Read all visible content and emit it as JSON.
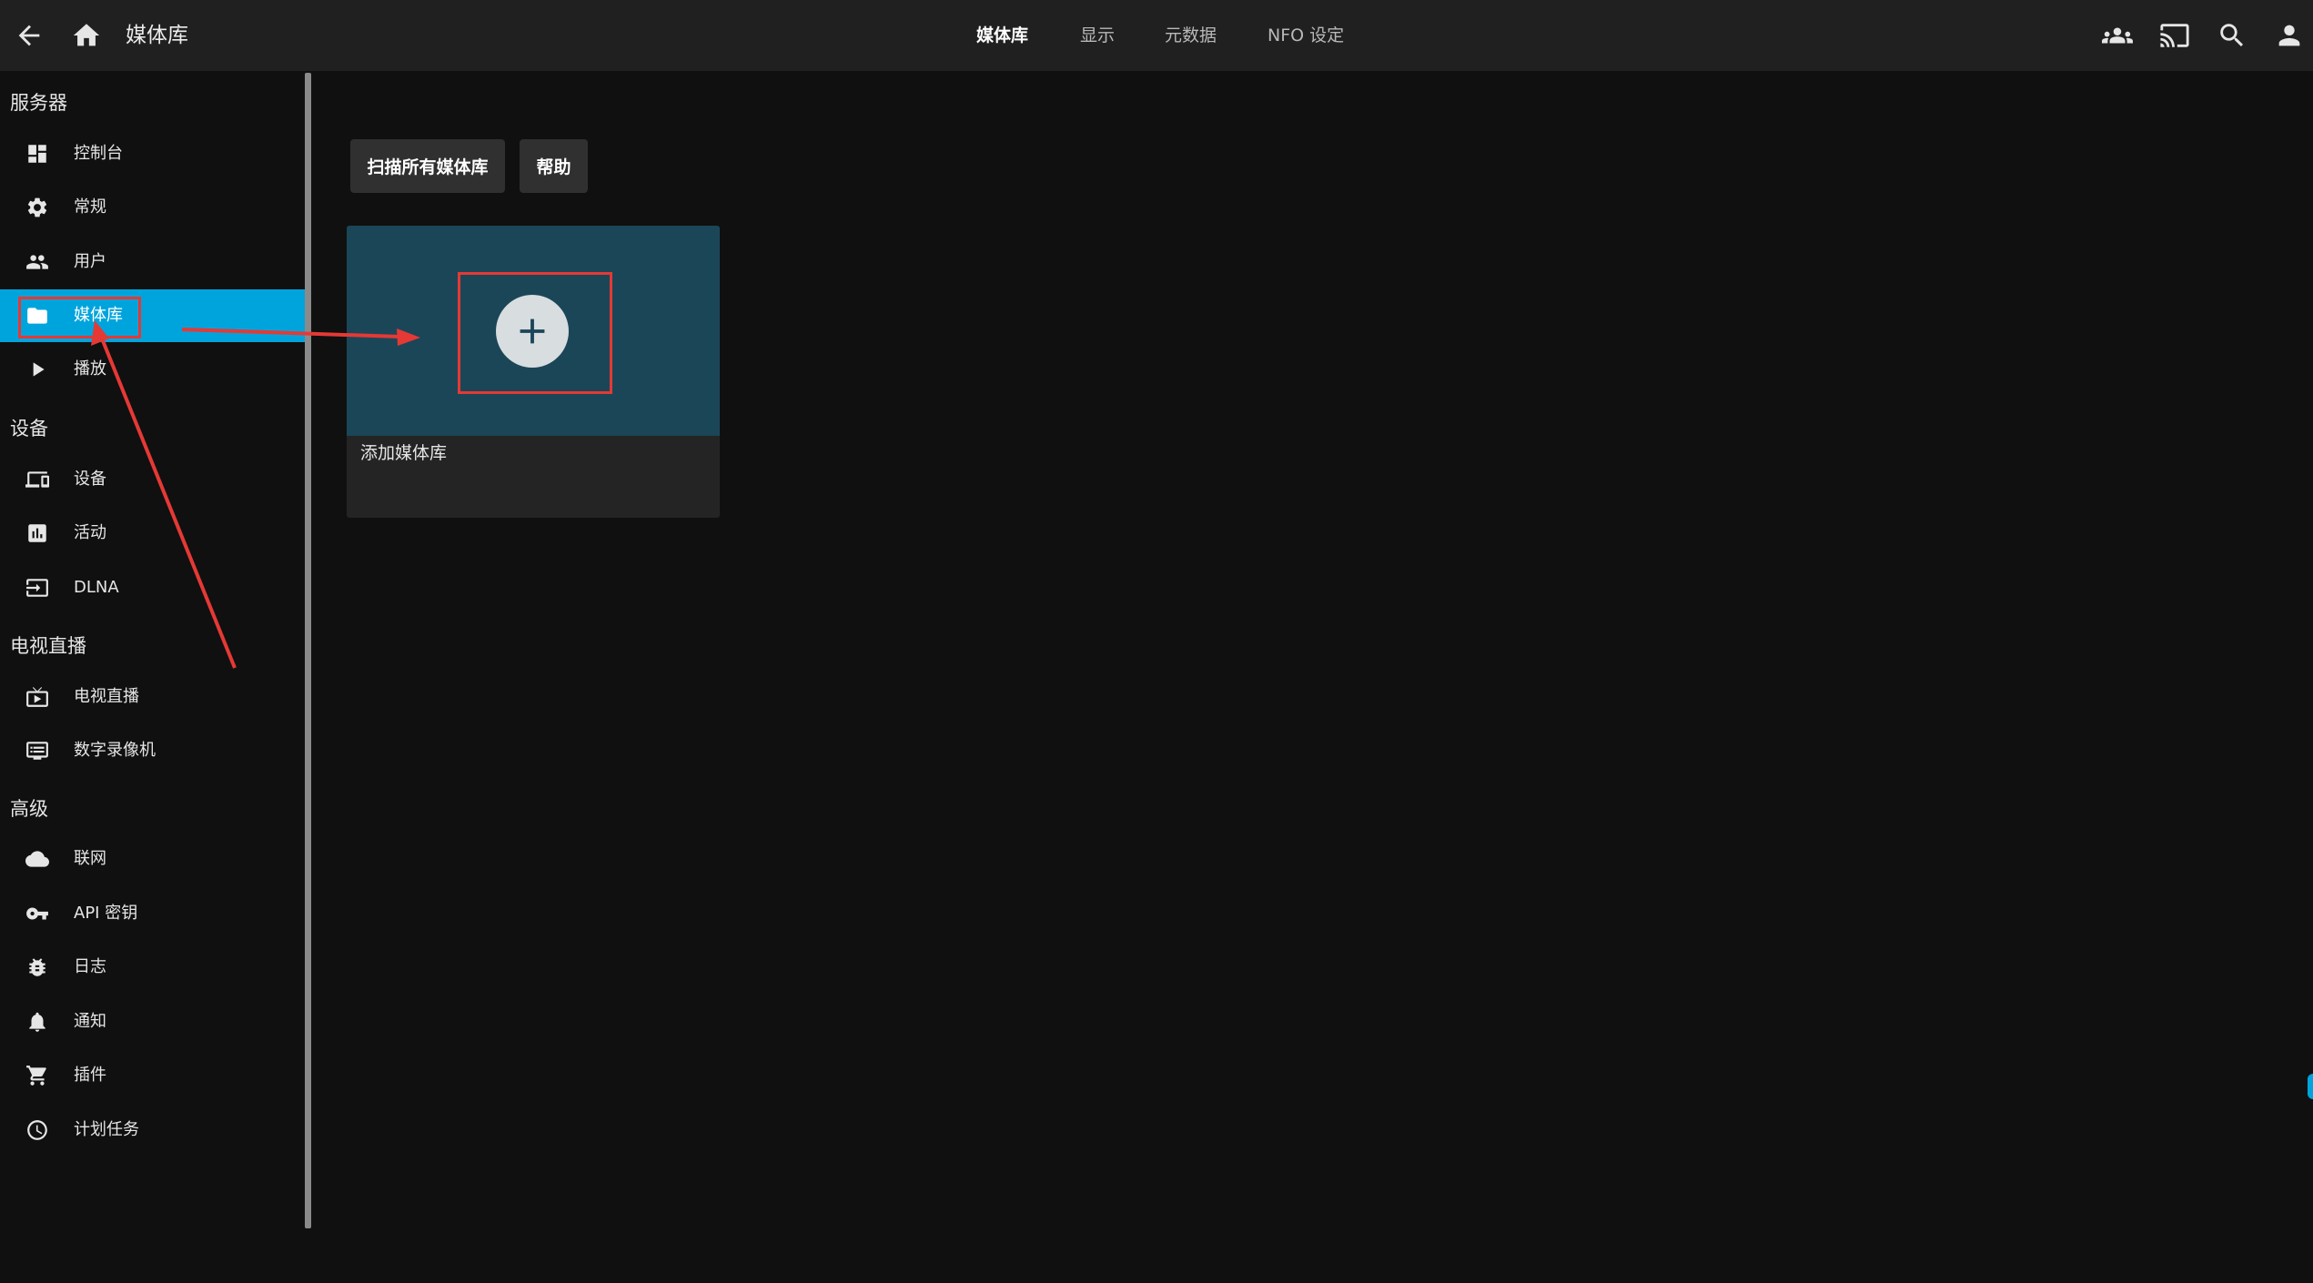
{
  "header": {
    "title": "媒体库",
    "tabs": [
      {
        "label": "媒体库",
        "active": true
      },
      {
        "label": "显示",
        "active": false
      },
      {
        "label": "元数据",
        "active": false
      },
      {
        "label": "NFO 设定",
        "active": false
      }
    ],
    "left_icons": [
      "back-arrow-icon",
      "home-icon"
    ],
    "right_icons": [
      "users-group-icon",
      "cast-icon",
      "search-icon",
      "user-icon"
    ]
  },
  "sidebar": {
    "sections": [
      {
        "title": "服务器",
        "items": [
          {
            "label": "控制台",
            "icon": "dashboard-icon"
          },
          {
            "label": "常规",
            "icon": "gear-icon"
          },
          {
            "label": "用户",
            "icon": "people-icon"
          },
          {
            "label": "媒体库",
            "icon": "folder-icon",
            "selected": true
          },
          {
            "label": "播放",
            "icon": "play-icon"
          }
        ]
      },
      {
        "title": "设备",
        "items": [
          {
            "label": "设备",
            "icon": "devices-icon"
          },
          {
            "label": "活动",
            "icon": "activity-chart-icon"
          },
          {
            "label": "DLNA",
            "icon": "input-icon"
          }
        ]
      },
      {
        "title": "电视直播",
        "items": [
          {
            "label": "电视直播",
            "icon": "live-tv-icon"
          },
          {
            "label": "数字录像机",
            "icon": "dvr-icon"
          }
        ]
      },
      {
        "title": "高级",
        "items": [
          {
            "label": "联网",
            "icon": "cloud-icon"
          },
          {
            "label": "API 密钥",
            "icon": "key-icon"
          },
          {
            "label": "日志",
            "icon": "bug-icon"
          },
          {
            "label": "通知",
            "icon": "bell-icon"
          },
          {
            "label": "插件",
            "icon": "cart-icon"
          },
          {
            "label": "计划任务",
            "icon": "clock-icon"
          }
        ]
      }
    ]
  },
  "main": {
    "scan_button": "扫描所有媒体库",
    "help_button": "帮助",
    "add_card": {
      "label": "添加媒体库",
      "icon": "add-circle-icon"
    }
  },
  "colors": {
    "accent": "#00a4dc",
    "header_bg": "#202020",
    "page_bg": "#101010",
    "card_image_bg": "#1b4658",
    "annotation": "#e53935"
  }
}
